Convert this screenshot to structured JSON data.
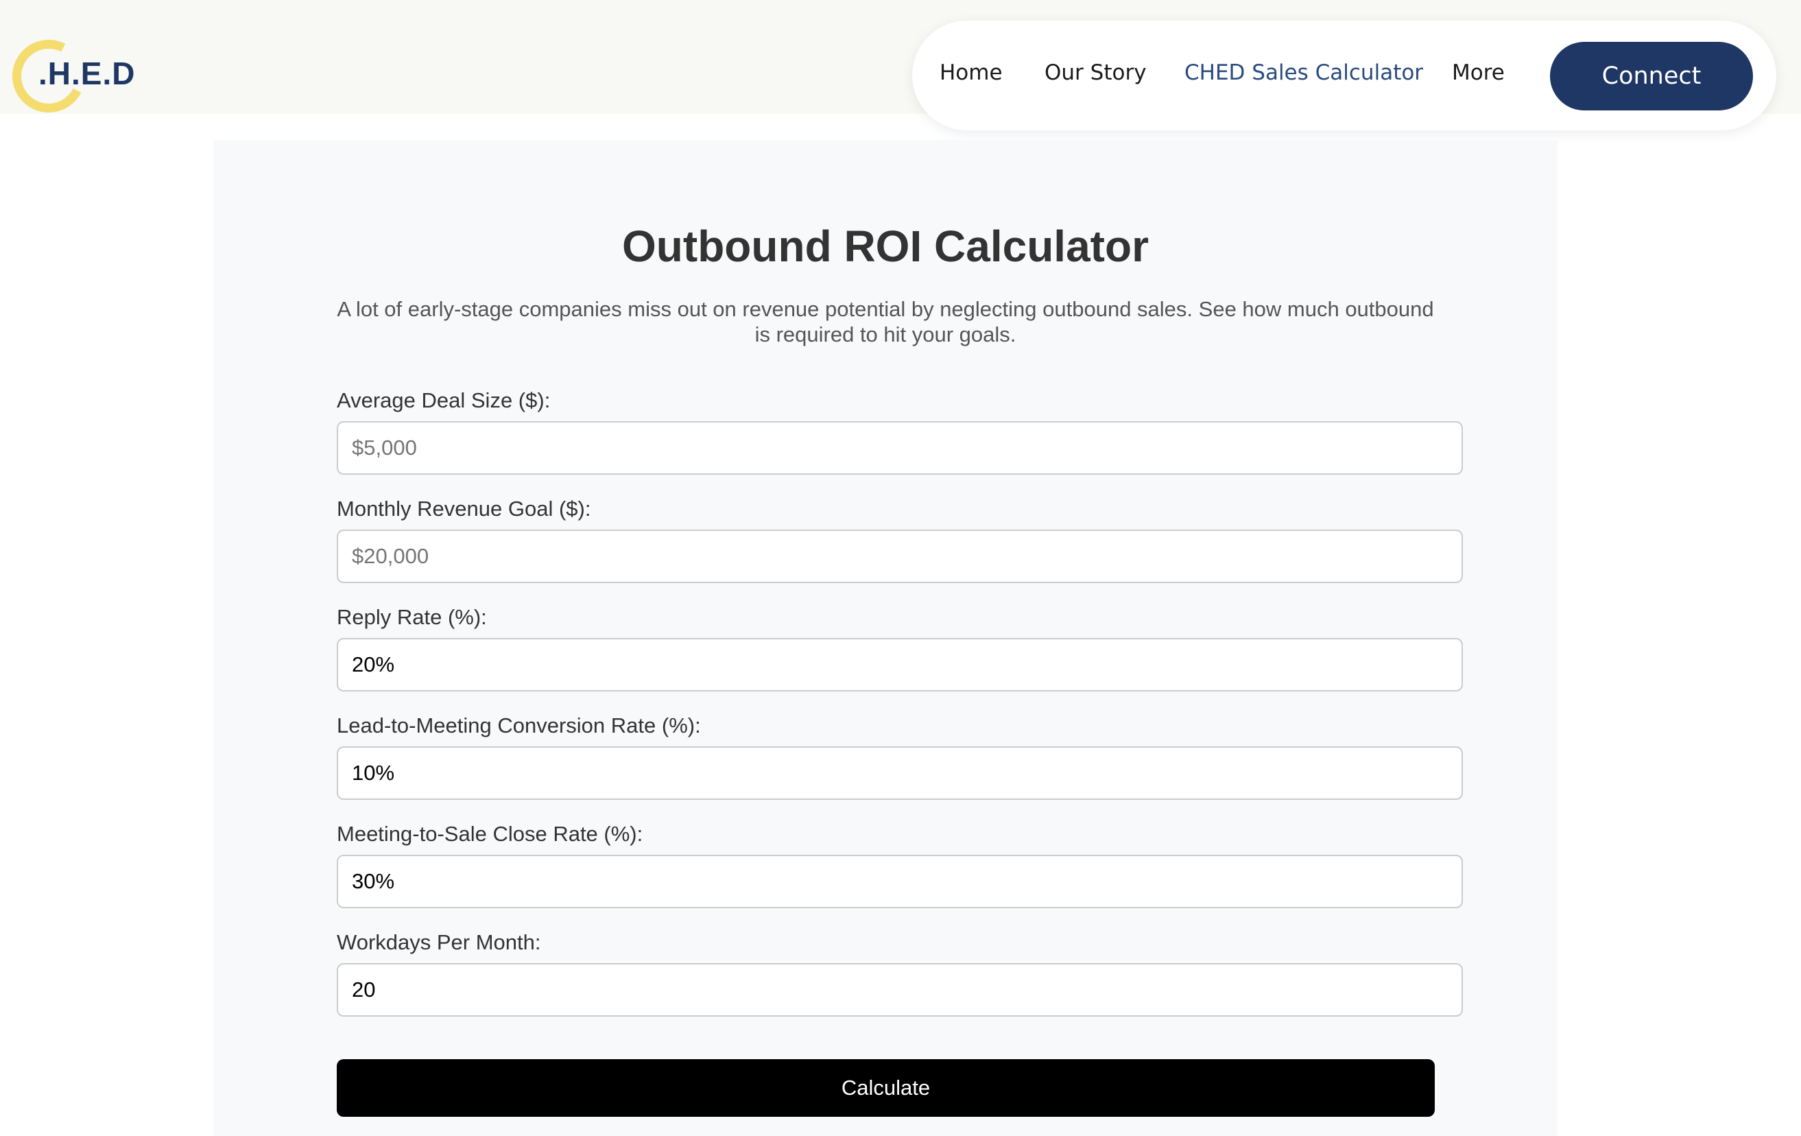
{
  "brand": {
    "logo_text": ".H.E.D",
    "accent_color": "#f4dc6e",
    "primary_color": "#1f3765"
  },
  "nav": {
    "items": [
      {
        "label": "Home",
        "active": false
      },
      {
        "label": "Our Story",
        "active": false
      },
      {
        "label": "CHED Sales Calculator",
        "active": true
      },
      {
        "label": "More",
        "active": false
      }
    ],
    "cta_label": "Connect"
  },
  "calculator": {
    "title": "Outbound ROI Calculator",
    "description": "A lot of early-stage companies miss out on revenue potential by neglecting outbound sales. See how much outbound is required to hit your goals.",
    "fields": [
      {
        "label": "Average Deal Size ($):",
        "value": "",
        "placeholder": "$5,000"
      },
      {
        "label": "Monthly Revenue Goal ($):",
        "value": "",
        "placeholder": "$20,000"
      },
      {
        "label": "Reply Rate (%):",
        "value": "20%",
        "placeholder": ""
      },
      {
        "label": "Lead-to-Meeting Conversion Rate (%):",
        "value": "10%",
        "placeholder": ""
      },
      {
        "label": "Meeting-to-Sale Close Rate (%):",
        "value": "30%",
        "placeholder": ""
      },
      {
        "label": "Workdays Per Month:",
        "value": "20",
        "placeholder": ""
      }
    ],
    "submit_label": "Calculate"
  }
}
